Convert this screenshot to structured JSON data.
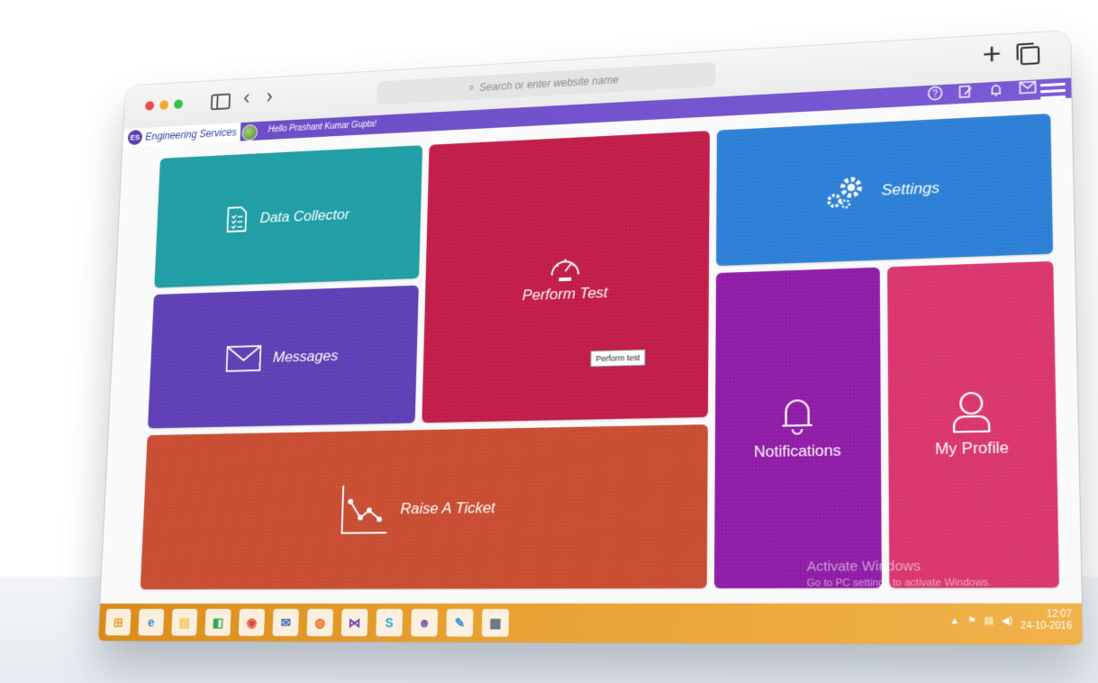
{
  "browser": {
    "url_placeholder": "Search or enter website name",
    "search_glyph": "⌕",
    "back_glyph": "‹",
    "forward_glyph": "›",
    "new_tab_glyph": "+"
  },
  "app": {
    "brand": "Engineering Services",
    "brand_logo": "ES",
    "greeting": "Hello Prashant Kumar Gupta!",
    "icons": [
      "help-icon",
      "edit-icon",
      "bell-icon",
      "mail-icon",
      "menu-icon"
    ]
  },
  "tiles": {
    "data_collector": "Data Collector",
    "messages": "Messages",
    "perform_test": "Perform Test",
    "perform_test_tooltip": "Perform test",
    "settings": "Settings",
    "notifications": "Notifications",
    "my_profile": "My Profile",
    "raise_ticket": "Raise A Ticket"
  },
  "watermark": {
    "title": "Activate Windows",
    "subtitle": "Go to PC settings to activate Windows."
  },
  "taskbar": {
    "apps": [
      {
        "name": "windows-start",
        "glyph": "⊞",
        "color": "#e7a032"
      },
      {
        "name": "internet-explorer",
        "glyph": "e",
        "color": "#2d8bd6"
      },
      {
        "name": "file-explorer",
        "glyph": "▤",
        "color": "#f3c44d"
      },
      {
        "name": "store",
        "glyph": "◧",
        "color": "#2aa84a"
      },
      {
        "name": "chrome",
        "glyph": "◉",
        "color": "#e14a3b"
      },
      {
        "name": "thunderbird",
        "glyph": "✉",
        "color": "#3a6ab8"
      },
      {
        "name": "firefox",
        "glyph": "◍",
        "color": "#e56a1f"
      },
      {
        "name": "visual-studio",
        "glyph": "⋈",
        "color": "#6d3aa8"
      },
      {
        "name": "skype",
        "glyph": "S",
        "color": "#1da7e0"
      },
      {
        "name": "pidgin",
        "glyph": "☻",
        "color": "#7a5ab0"
      },
      {
        "name": "paint",
        "glyph": "✎",
        "color": "#3d8fcf"
      },
      {
        "name": "news-app",
        "glyph": "▦",
        "color": "#5a6b7a"
      }
    ],
    "time": "12:07",
    "date": "24-10-2016"
  },
  "colors": {
    "data_collector": "#1f9ea6",
    "messages": "#5e3fb5",
    "perform_test": "#c11c4a",
    "settings": "#2c7fd6",
    "notifications": "#8f1ca6",
    "my_profile": "#d9356f",
    "raise_ticket": "#c84d32",
    "app_bar": "#6a4bc4"
  }
}
